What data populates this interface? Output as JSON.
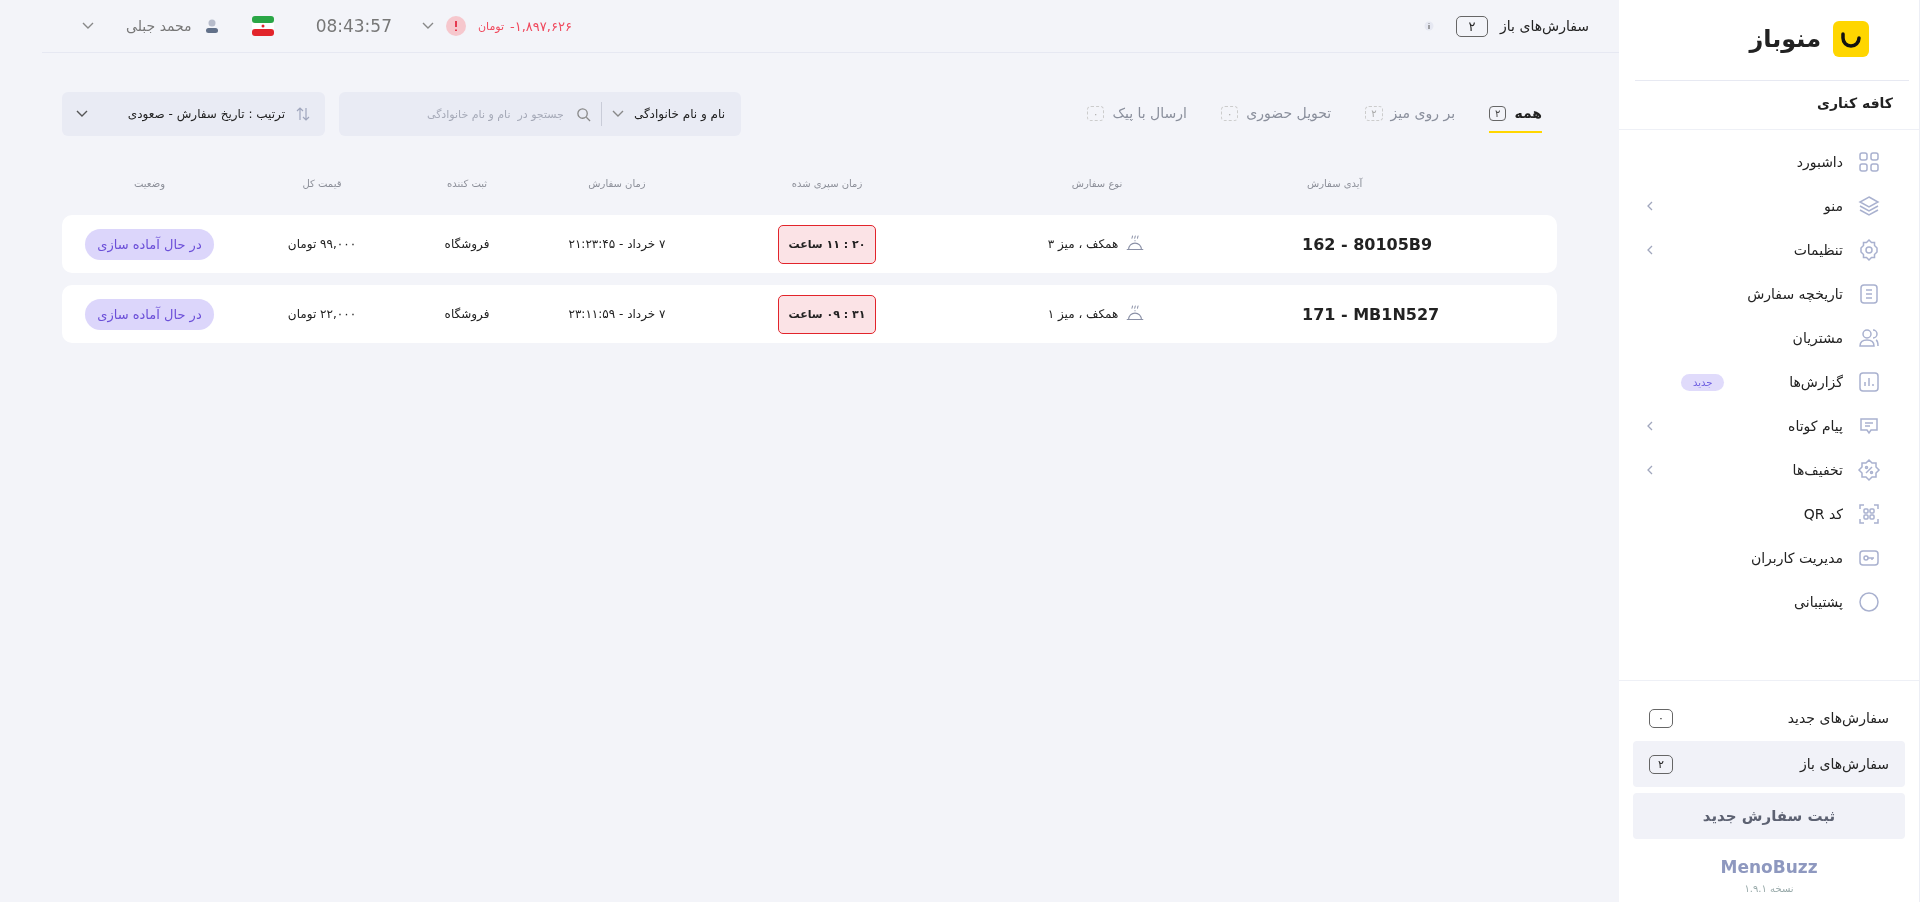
{
  "topbar": {
    "open_orders": {
      "label": "سفارش‌های باز",
      "count": "۲"
    },
    "balance": {
      "amount": "-۱,۸۹۷,۶۲۶",
      "currency": "تومان"
    },
    "clock": "08:43:57",
    "user": "محمد جبلی"
  },
  "tabs": [
    {
      "label": "همه",
      "count": "۲",
      "selected": true
    },
    {
      "label": "بر روی میز",
      "count": "۲",
      "selected": false
    },
    {
      "label": "تحویل حضوری",
      "count": "۰",
      "selected": false
    },
    {
      "label": "ارسال با پیک",
      "count": "۰",
      "selected": false
    }
  ],
  "search": {
    "field": "نام و نام خانوادگی",
    "placeholder": "جستجو در  نام و نام خانوادگی"
  },
  "sort": {
    "value": "ترتیب : تاریخ سفارش - صعودی"
  },
  "table": {
    "columns": [
      "آیدی سفارش",
      "نوع سفارش",
      "زمان سپری شده",
      "زمان سفارش",
      "ثبت کننده",
      "قیمت کل",
      "وضعیت"
    ],
    "rows": [
      {
        "id": "162 - 80105B9",
        "type": "همکف ، میز ۳",
        "elapsed": "۲۰ : ۱۱ ساعت",
        "time": "۷ خرداد - ۲۱:۲۳:۴۵",
        "creator": "فروشگاه",
        "price": "۹۹,۰۰۰ تومان",
        "status": "در حال آماده سازی"
      },
      {
        "id": "171 - MB1N527",
        "type": "همکف ، میز ۱",
        "elapsed": "۳۱ : ۰۹ ساعت",
        "time": "۷ خرداد - ۲۳:۱۱:۵۹",
        "creator": "فروشگاه",
        "price": "۲۲,۰۰۰ تومان",
        "status": "در حال آماده سازی"
      }
    ]
  },
  "sidebar": {
    "brand": "منوباز",
    "venue": "کافه کناری",
    "items": [
      {
        "label": "داشبورد",
        "has_submenu": false
      },
      {
        "label": "منو",
        "has_submenu": true
      },
      {
        "label": "تنظیمات",
        "has_submenu": true
      },
      {
        "label": "تاریخچه سفارش",
        "has_submenu": false
      },
      {
        "label": "مشتریان",
        "has_submenu": false
      },
      {
        "label": "گزارش‌ها",
        "has_submenu": false,
        "badge": "جدید"
      },
      {
        "label": "پیام کوتاه",
        "has_submenu": true
      },
      {
        "label": "تخفیف‌ها",
        "has_submenu": true
      },
      {
        "label": "کد QR",
        "has_submenu": false
      },
      {
        "label": "مدیریت کاربران",
        "has_submenu": false
      },
      {
        "label": "پشتیبانی",
        "has_submenu": false
      }
    ],
    "order_queues": [
      {
        "label": "سفارش‌های جدید",
        "count": "۰",
        "selected": false
      },
      {
        "label": "سفارش‌های باز",
        "count": "۲",
        "selected": true
      }
    ],
    "new_order_button": "ثبت سفارش جدید",
    "footer": {
      "logo": "MenoBuzz",
      "version": "نسخه ۱.۹.۱"
    }
  }
}
